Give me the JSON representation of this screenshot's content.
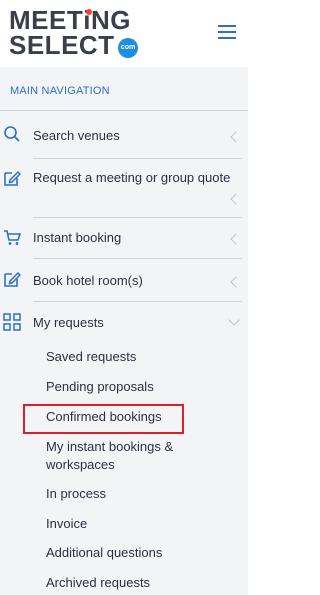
{
  "brand": {
    "line1_a": "MEET",
    "line1_b": "NG",
    "line2": "SELECT",
    "badge": "com"
  },
  "nav": {
    "title": "MAIN NAVIGATION",
    "items": [
      {
        "label": "Search venues",
        "icon": "search-icon"
      },
      {
        "label": "Request a meeting or group quote",
        "icon": "edit-icon"
      },
      {
        "label": "Instant booking",
        "icon": "cart-icon"
      },
      {
        "label": "Book hotel room(s)",
        "icon": "edit-icon"
      },
      {
        "label": "My requests",
        "icon": "grid-icon"
      }
    ],
    "submenu": [
      "Saved requests",
      "Pending proposals",
      "Confirmed bookings",
      "My instant bookings &",
      "workspaces",
      "In process",
      "Invoice",
      "Additional questions",
      "Archived requests"
    ]
  },
  "colors": {
    "accent": "#2b6fcf",
    "highlight": "#d9202c"
  }
}
